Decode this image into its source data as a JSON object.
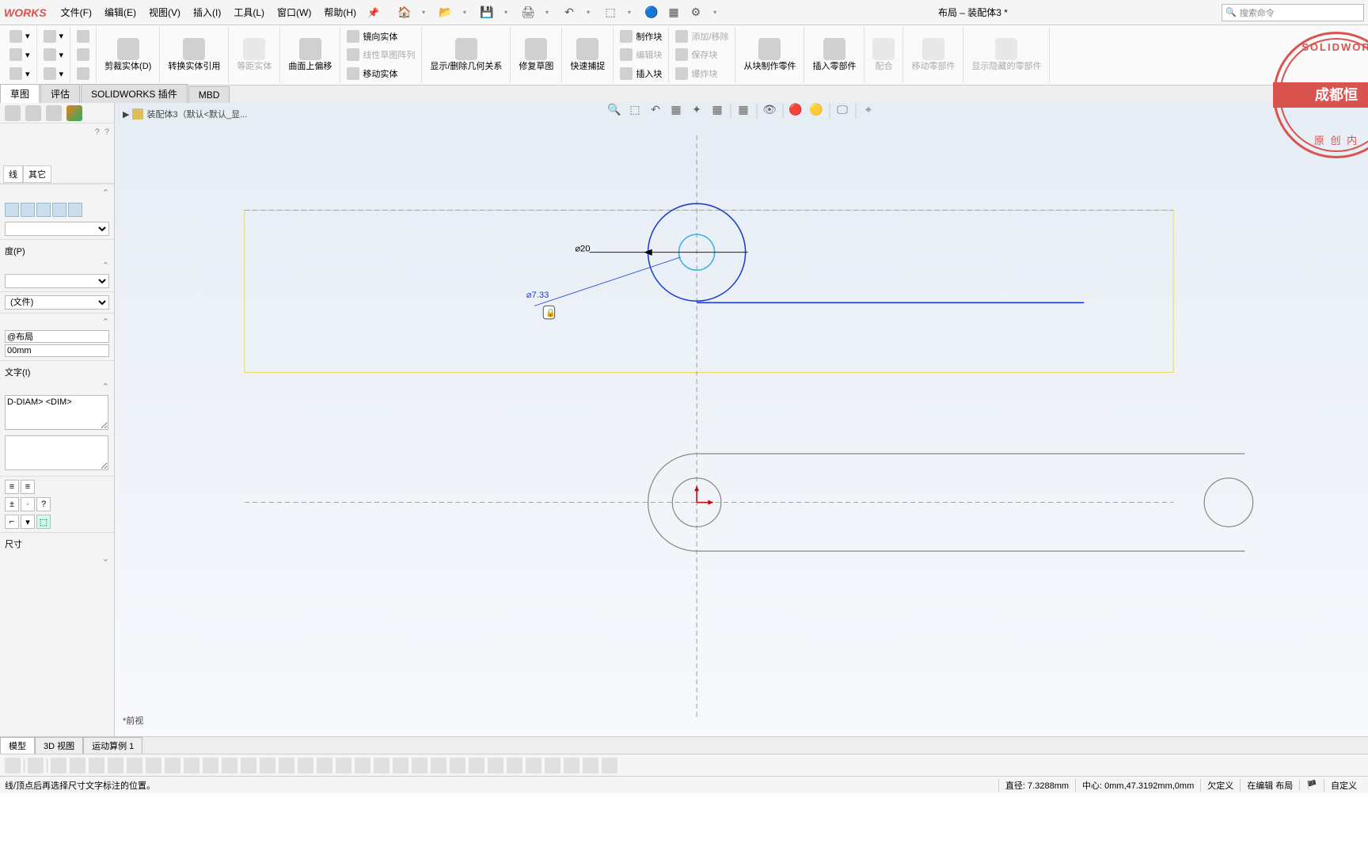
{
  "app": {
    "logo": "WORKS",
    "title": "布局 – 装配体3 *"
  },
  "menu": {
    "file": "文件(F)",
    "edit": "编辑(E)",
    "view": "视图(V)",
    "insert": "插入(I)",
    "tools": "工具(L)",
    "window": "窗口(W)",
    "help": "帮助(H)"
  },
  "search": {
    "placeholder": "搜索命令"
  },
  "ribbon": {
    "trim": {
      "a": "剪裁实体(D)",
      "b": "转换实体引用"
    },
    "offset": "等距实体",
    "curve": "曲面上偏移",
    "mirror": "镜向实体",
    "pattern": "线性草图阵列",
    "move": "移动实体",
    "rels": "显示/删除几何关系",
    "repair": "修复草图",
    "snap": "快速捕捉",
    "block_make": "制作块",
    "block_edit": "编辑块",
    "block_add": "添加/移除",
    "block_insert": "插入块",
    "block_save": "保存块",
    "block_explode": "爆炸块",
    "from_block": "从块制作零件",
    "insert_comp": "插入零部件",
    "mate": "配合",
    "move_comp": "移动零部件",
    "show_hidden": "显示隐藏的零部件"
  },
  "tabs": {
    "sketch": "草图",
    "evaluate": "评估",
    "plugins": "SOLIDWORKS 插件",
    "mbd": "MBD"
  },
  "fm": {
    "tree_root": "装配体3（默认<默认_显...",
    "subtab": "线",
    "subtab2": "其它",
    "hdr1": "度(P)",
    "style_label": "(文件)",
    "name_label": "",
    "name_value": "@布局",
    "val_label": "",
    "val_value": "00mm",
    "text_hdr": "文字(I)",
    "text_val": "D-DIAM> <DIM>",
    "dim_hdr": "尺寸"
  },
  "bottom_tabs": {
    "model": "模型",
    "view3d": "3D 视图",
    "motion": "运动算例 1"
  },
  "triad": "*前视",
  "dims": {
    "d1": "⌀20",
    "d2": "⌀7.33"
  },
  "status": {
    "hint": "线/顶点后再选择尺寸文字标注的位置。",
    "diam": "直径: 7.3288mm",
    "center": "中心: 0mm,47.3192mm,0mm",
    "def": "欠定义",
    "edit": "在编辑 布局",
    "custom": "自定义"
  },
  "watermark": {
    "top": "SOLIDWOR",
    "band": "成都恒",
    "bottom": "原 创 内"
  }
}
